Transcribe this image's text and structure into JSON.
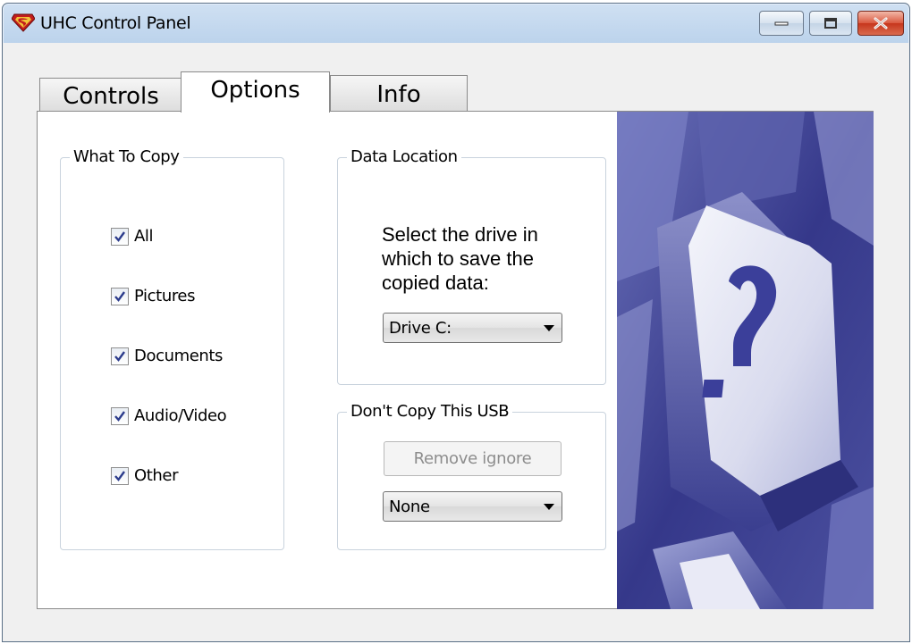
{
  "window": {
    "title": "UHC Control Panel"
  },
  "tabs": [
    {
      "label": "Controls"
    },
    {
      "label": "Options"
    },
    {
      "label": "Info"
    }
  ],
  "what_to_copy": {
    "title": "What To Copy",
    "items": [
      {
        "label": "All",
        "checked": true
      },
      {
        "label": "Pictures",
        "checked": true
      },
      {
        "label": "Documents",
        "checked": true
      },
      {
        "label": "Audio/Video",
        "checked": true
      },
      {
        "label": "Other",
        "checked": true
      }
    ]
  },
  "data_location": {
    "title": "Data Location",
    "instruction": "Select the drive in which to save the copied data:",
    "drive_selected": "Drive C:"
  },
  "dont_copy": {
    "title": "Don't  Copy This USB",
    "remove_button": "Remove ignore",
    "usb_selected": "None"
  },
  "colors": {
    "accent": "#4a4f9a",
    "close_button": "#c6361c"
  }
}
